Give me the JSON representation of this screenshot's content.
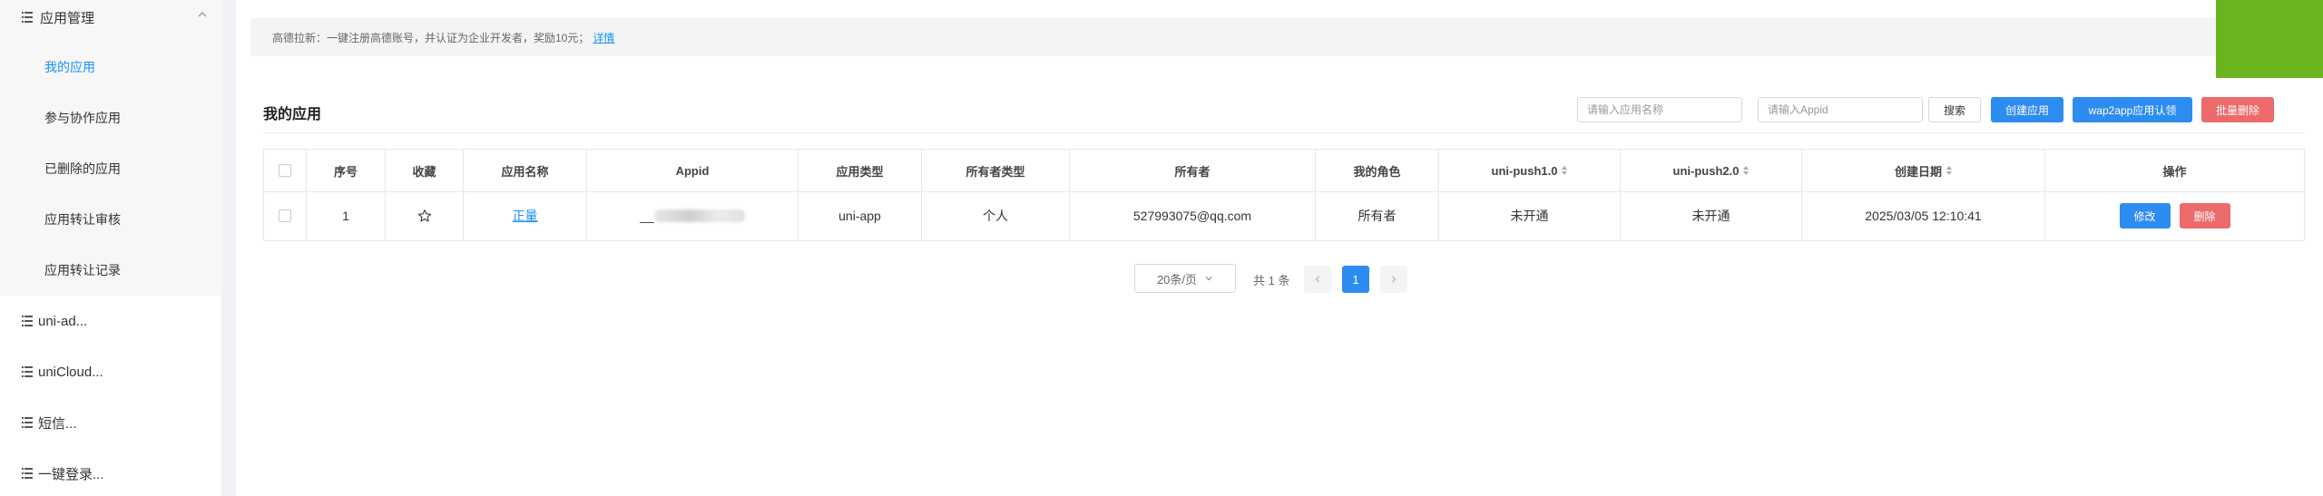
{
  "sidebar": {
    "group_label": "应用管理",
    "sub_items": [
      {
        "label": "我的应用",
        "active": true
      },
      {
        "label": "参与协作应用",
        "active": false
      },
      {
        "label": "已删除的应用",
        "active": false
      },
      {
        "label": "应用转让审核",
        "active": false
      },
      {
        "label": "应用转让记录",
        "active": false
      }
    ],
    "items": [
      {
        "label": "uni-ad..."
      },
      {
        "label": "uniCloud..."
      },
      {
        "label": "短信..."
      },
      {
        "label": "一键登录..."
      }
    ]
  },
  "notice": {
    "text": "高德拉新：一键注册高德账号，并认证为企业开发者，奖励10元；",
    "link": "详情"
  },
  "section": {
    "title": "我的应用"
  },
  "toolbar": {
    "name_placeholder": "请输入应用名称",
    "appid_placeholder": "请输入Appid",
    "search_label": "搜索",
    "create_label": "创建应用",
    "wap2app_label": "wap2app应用认领",
    "batch_delete_label": "批量删除"
  },
  "table": {
    "headers": {
      "index": "序号",
      "favorite": "收藏",
      "name": "应用名称",
      "appid": "Appid",
      "type": "应用类型",
      "owner_type": "所有者类型",
      "owner": "所有者",
      "role": "我的角色",
      "push1": "uni-push1.0",
      "push2": "uni-push2.0",
      "created": "创建日期",
      "actions": "操作"
    },
    "rows": [
      {
        "index": "1",
        "name": "正量",
        "appid": "__",
        "type": "uni-app",
        "owner_type": "个人",
        "owner": "527993075@qq.com",
        "role": "所有者",
        "push1": "未开通",
        "push2": "未开通",
        "created": "2025/03/05 12:10:41",
        "edit_label": "修改",
        "delete_label": "删除"
      }
    ]
  },
  "pagination": {
    "page_size": "20条/页",
    "total": "共 1 条",
    "current_page": "1"
  },
  "colors": {
    "primary": "#2d8cf0",
    "danger": "#ed6a6a",
    "link": "#1890ff",
    "corner_green": "#6ab41f"
  }
}
